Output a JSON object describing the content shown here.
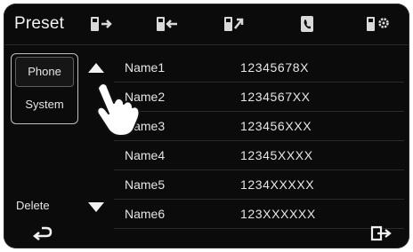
{
  "header": {
    "title": "Preset"
  },
  "toolbar_icons": [
    "phone-send-icon",
    "phone-receive-icon",
    "phone-out-icon",
    "contact-book-icon",
    "phone-settings-icon"
  ],
  "sidebar": {
    "items": [
      {
        "label": "Phone"
      },
      {
        "label": "System"
      }
    ]
  },
  "presets": [
    {
      "name": "Name1",
      "number": "12345678X"
    },
    {
      "name": "Name2",
      "number": "1234567XX"
    },
    {
      "name": "Name3",
      "number": "123456XXX"
    },
    {
      "name": "Name4",
      "number": "12345XXXX"
    },
    {
      "name": "Name5",
      "number": "1234XXXXX"
    },
    {
      "name": "Name6",
      "number": "123XXXXXX"
    }
  ],
  "footer": {
    "delete_label": "Delete"
  },
  "colors": {
    "background": "#0b0b0b",
    "text": "#e6e6e6"
  }
}
